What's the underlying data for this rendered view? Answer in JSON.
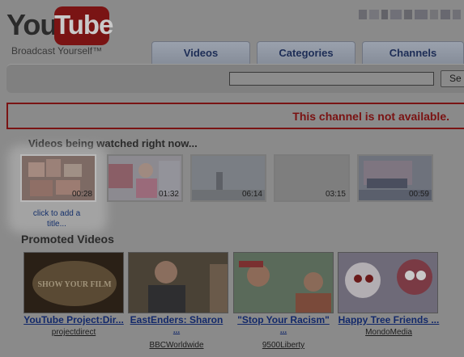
{
  "logo": {
    "you": "You",
    "tube": "Tube",
    "tagline": "Broadcast Yourself™"
  },
  "nav": {
    "tabs": [
      "Videos",
      "Categories",
      "Channels"
    ]
  },
  "search": {
    "button_label": "Se",
    "value": ""
  },
  "error": {
    "message": "This channel is not available."
  },
  "watching": {
    "title": "Videos being watched right now...",
    "items": [
      {
        "duration": "00:28"
      },
      {
        "duration": "01:32"
      },
      {
        "duration": "06:14"
      },
      {
        "duration": "03:15"
      },
      {
        "duration": "00:59"
      }
    ],
    "add_title_line1": "click to add a",
    "add_title_line2": "title..."
  },
  "promoted": {
    "title": "Promoted Videos",
    "items": [
      {
        "title": "YouTube Project:Dir...",
        "title2": "",
        "user": "projectdirect",
        "thumb_text": "SHOW YOUR FILM"
      },
      {
        "title": "EastEnders: Sharon",
        "title2": "...",
        "user": "BBCWorldwide"
      },
      {
        "title": "\"Stop Your Racism\"",
        "title2": "...",
        "user": "9500Liberty"
      },
      {
        "title": "Happy Tree Friends ...",
        "title2": "",
        "user": "MondoMedia"
      }
    ]
  }
}
